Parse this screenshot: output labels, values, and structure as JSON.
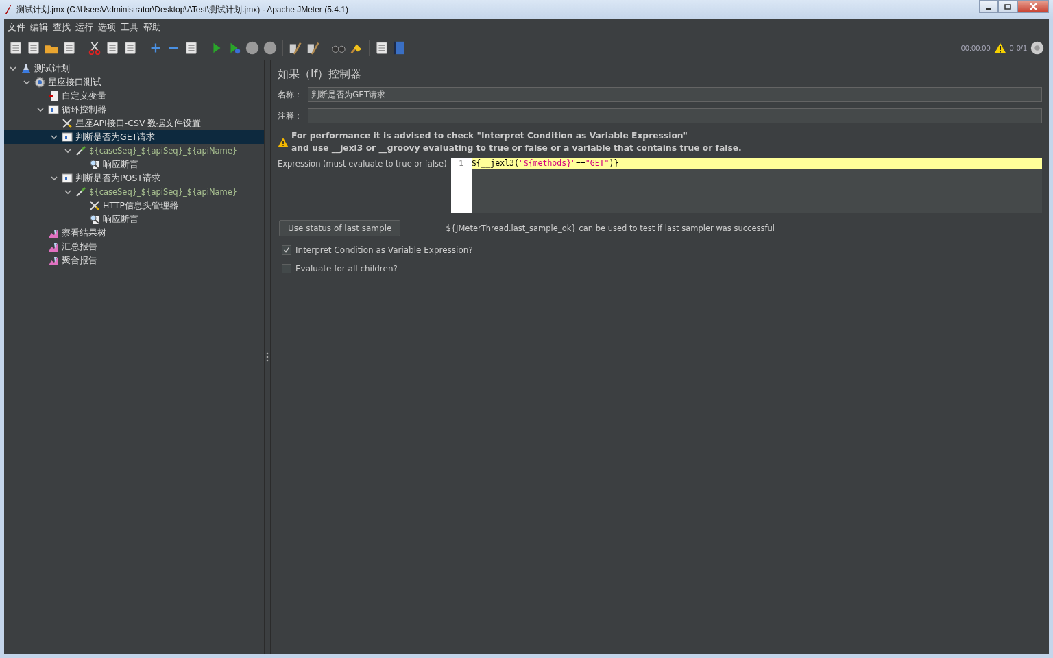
{
  "window": {
    "title": "测试计划.jmx (C:\\Users\\Administrator\\Desktop\\ATest\\测试计划.jmx) - Apache JMeter (5.4.1)"
  },
  "menu": [
    "文件",
    "编辑",
    "查找",
    "运行",
    "选项",
    "工具",
    "帮助"
  ],
  "status": {
    "timer": "00:00:00",
    "warnings": "0",
    "threads": "0/1"
  },
  "tree": [
    {
      "label": "测试计划",
      "kind": "plan",
      "expanded": true,
      "selected": false,
      "children": [
        {
          "label": "星座接口测试",
          "kind": "thread-group",
          "expanded": true,
          "selected": false,
          "children": [
            {
              "label": "自定义变量",
              "kind": "variables",
              "selected": false
            },
            {
              "label": "循环控制器",
              "kind": "controller",
              "expanded": true,
              "selected": false,
              "children": [
                {
                  "label": "星座API接口-CSV 数据文件设置",
                  "kind": "config",
                  "selected": false
                },
                {
                  "label": "判断是否为GET请求",
                  "kind": "controller",
                  "expanded": true,
                  "selected": true,
                  "children": [
                    {
                      "label": "${caseSeq}_${apiSeq}_${apiName}",
                      "kind": "sampler",
                      "expanded": true,
                      "selected": false,
                      "children": [
                        {
                          "label": "响应断言",
                          "kind": "assertion",
                          "selected": false
                        }
                      ]
                    }
                  ]
                },
                {
                  "label": "判断是否为POST请求",
                  "kind": "controller",
                  "expanded": true,
                  "selected": false,
                  "children": [
                    {
                      "label": "${caseSeq}_${apiSeq}_${apiName}",
                      "kind": "sampler",
                      "expanded": true,
                      "selected": false,
                      "children": [
                        {
                          "label": "HTTP信息头管理器",
                          "kind": "config",
                          "selected": false
                        },
                        {
                          "label": "响应断言",
                          "kind": "assertion",
                          "selected": false
                        }
                      ]
                    }
                  ]
                }
              ]
            },
            {
              "label": "察看结果树",
              "kind": "listener",
              "selected": false
            },
            {
              "label": "汇总报告",
              "kind": "listener",
              "selected": false
            },
            {
              "label": "聚合报告",
              "kind": "listener",
              "selected": false
            }
          ]
        }
      ]
    }
  ],
  "panel": {
    "title": "如果（If）控制器",
    "name_label": "名称：",
    "name_value": "判断是否为GET请求",
    "comment_label": "注释：",
    "warning": [
      "For performance it is advised to check \"Interpret Condition as Variable Expression\"",
      "and use __jexl3 or __groovy evaluating to true or false or a variable that contains true or false."
    ],
    "expression_label": "Expression (must evaluate to true or false)",
    "line_number": "1",
    "code": [
      {
        "text": "${",
        "kind": "plain"
      },
      {
        "text": "__jexl3(",
        "kind": "plain"
      },
      {
        "text": "\"${methods}\"",
        "kind": "string"
      },
      {
        "text": "==",
        "kind": "plain"
      },
      {
        "text": "\"GET\"",
        "kind": "string"
      },
      {
        "text": ")",
        "kind": "plain"
      },
      {
        "text": "}",
        "kind": "plain"
      }
    ],
    "button": "Use status of last sample",
    "hint": "${JMeterThread.last_sample_ok} can be used to test if last sampler was successful",
    "options": [
      {
        "label": "Interpret Condition as Variable Expression?",
        "checked": true
      },
      {
        "label": "Evaluate for all children?",
        "checked": false
      }
    ]
  }
}
